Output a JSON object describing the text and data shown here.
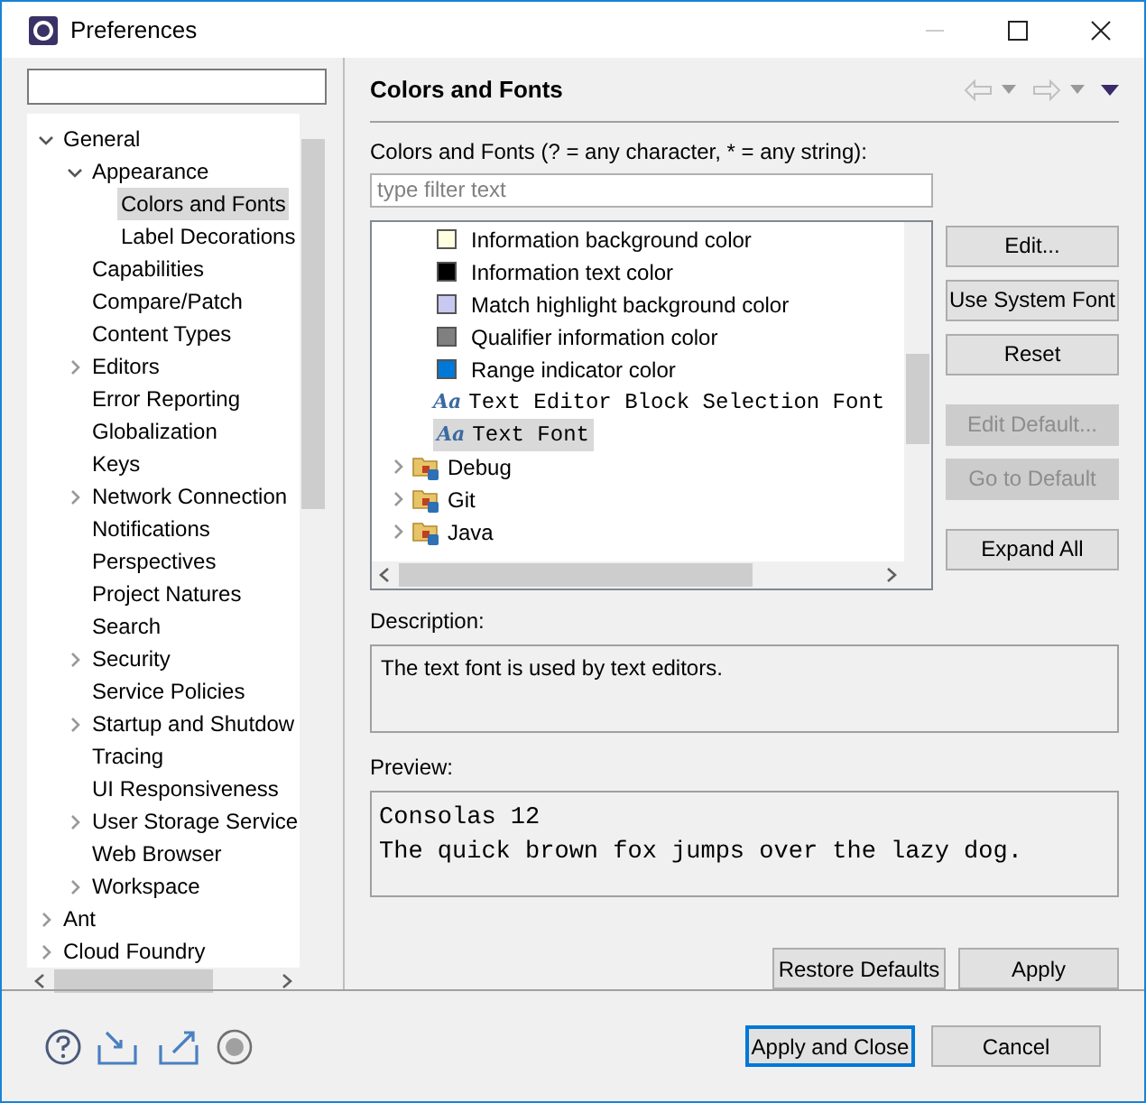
{
  "window": {
    "title": "Preferences"
  },
  "nav_tree": [
    {
      "label": "General",
      "expanded": true,
      "selected": false,
      "children": [
        {
          "label": "Appearance",
          "expanded": true,
          "selected": false,
          "children": [
            {
              "label": "Colors and Fonts",
              "selected": true
            },
            {
              "label": "Label Decorations",
              "selected": false
            }
          ]
        },
        {
          "label": "Capabilities",
          "selected": false
        },
        {
          "label": "Compare/Patch",
          "selected": false
        },
        {
          "label": "Content Types",
          "selected": false
        },
        {
          "label": "Editors",
          "expanded": false,
          "selected": false
        },
        {
          "label": "Error Reporting",
          "selected": false
        },
        {
          "label": "Globalization",
          "selected": false
        },
        {
          "label": "Keys",
          "selected": false
        },
        {
          "label": "Network Connection",
          "expanded": false,
          "selected": false
        },
        {
          "label": "Notifications",
          "selected": false
        },
        {
          "label": "Perspectives",
          "selected": false
        },
        {
          "label": "Project Natures",
          "selected": false
        },
        {
          "label": "Search",
          "selected": false
        },
        {
          "label": "Security",
          "expanded": false,
          "selected": false
        },
        {
          "label": "Service Policies",
          "selected": false
        },
        {
          "label": "Startup and Shutdow",
          "expanded": false,
          "selected": false
        },
        {
          "label": "Tracing",
          "selected": false
        },
        {
          "label": "UI Responsiveness",
          "selected": false
        },
        {
          "label": "User Storage Service",
          "expanded": false,
          "selected": false
        },
        {
          "label": "Web Browser",
          "selected": false
        },
        {
          "label": "Workspace",
          "expanded": false,
          "selected": false
        }
      ]
    },
    {
      "label": "Ant",
      "expanded": false,
      "selected": false
    },
    {
      "label": "Cloud Foundry",
      "expanded": false,
      "selected": false
    }
  ],
  "page": {
    "title": "Colors and Fonts",
    "filter_label": "Colors and Fonts (? = any character, * = any string):",
    "filter": {
      "placeholder": "type filter text"
    },
    "items": [
      {
        "kind": "color",
        "label": "Information background color",
        "color": "#ffffe1",
        "selected": false
      },
      {
        "kind": "color",
        "label": "Information text color",
        "color": "#000000",
        "selected": false
      },
      {
        "kind": "color",
        "label": "Match highlight background color",
        "color": "#c8c8f0",
        "selected": false
      },
      {
        "kind": "color",
        "label": "Qualifier information color",
        "color": "#808080",
        "selected": false
      },
      {
        "kind": "color",
        "label": "Range indicator color",
        "color": "#0078d7",
        "selected": false
      },
      {
        "kind": "font",
        "glyph": "Aa",
        "label": "Text Editor Block Selection Font",
        "selected": false
      },
      {
        "kind": "font",
        "glyph": "Aa",
        "label": "Text Font",
        "selected": true
      },
      {
        "kind": "category",
        "label": "Debug",
        "expanded": false,
        "selected": false
      },
      {
        "kind": "category",
        "label": "Git",
        "expanded": false,
        "selected": false
      },
      {
        "kind": "category",
        "label": "Java",
        "expanded": false,
        "selected": false
      }
    ],
    "side_buttons": [
      {
        "label": "Edit...",
        "disabled": false
      },
      {
        "label": "Use System Font",
        "disabled": false
      },
      {
        "label": "Reset",
        "disabled": false
      },
      {
        "label": "Edit Default...",
        "disabled": true
      },
      {
        "label": "Go to Default",
        "disabled": true
      },
      {
        "label": "Expand All",
        "disabled": false
      }
    ],
    "description_label": "Description:",
    "description": "The text font is used by text editors.",
    "preview_label": "Preview:",
    "preview": [
      "Consolas 12",
      "The quick brown fox jumps over the lazy dog."
    ],
    "buttons": [
      "Restore Defaults",
      "Apply"
    ]
  },
  "footer_buttons": [
    {
      "label": "Apply and Close",
      "default": true
    },
    {
      "label": "Cancel",
      "default": false
    }
  ]
}
